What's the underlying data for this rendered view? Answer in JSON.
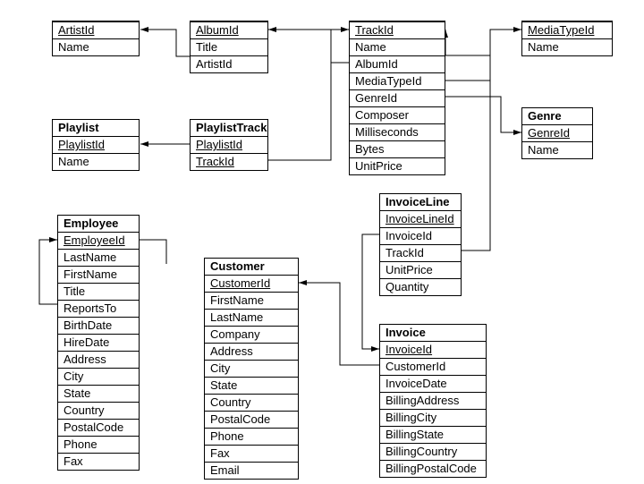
{
  "entities": {
    "artist": {
      "title": "",
      "fields": [
        {
          "name": "ArtistId",
          "pk": true
        },
        {
          "name": "Name"
        }
      ]
    },
    "album": {
      "title": "",
      "fields": [
        {
          "name": "AlbumId",
          "pk": true
        },
        {
          "name": "Title"
        },
        {
          "name": "ArtistId"
        }
      ]
    },
    "track": {
      "title": "",
      "fields": [
        {
          "name": "TrackId",
          "pk": true
        },
        {
          "name": "Name"
        },
        {
          "name": "AlbumId"
        },
        {
          "name": "MediaTypeId"
        },
        {
          "name": "GenreId"
        },
        {
          "name": "Composer"
        },
        {
          "name": "Milliseconds"
        },
        {
          "name": "Bytes"
        },
        {
          "name": "UnitPrice"
        }
      ]
    },
    "mediatype": {
      "title": "",
      "fields": [
        {
          "name": "MediaTypeId",
          "pk": true
        },
        {
          "name": "Name"
        }
      ]
    },
    "genre": {
      "title": "Genre",
      "fields": [
        {
          "name": "GenreId",
          "pk": true
        },
        {
          "name": "Name"
        }
      ]
    },
    "playlist": {
      "title": "Playlist",
      "fields": [
        {
          "name": "PlaylistId",
          "pk": true
        },
        {
          "name": "Name"
        }
      ]
    },
    "playlisttrack": {
      "title": "PlaylistTrack",
      "fields": [
        {
          "name": "PlaylistId",
          "pk": true
        },
        {
          "name": "TrackId",
          "pk": true
        }
      ]
    },
    "employee": {
      "title": "Employee",
      "fields": [
        {
          "name": "EmployeeId",
          "pk": true
        },
        {
          "name": "LastName"
        },
        {
          "name": "FirstName"
        },
        {
          "name": "Title"
        },
        {
          "name": "ReportsTo"
        },
        {
          "name": "BirthDate"
        },
        {
          "name": "HireDate"
        },
        {
          "name": "Address"
        },
        {
          "name": "City"
        },
        {
          "name": "State"
        },
        {
          "name": "Country"
        },
        {
          "name": "PostalCode"
        },
        {
          "name": "Phone"
        },
        {
          "name": "Fax"
        }
      ]
    },
    "customer": {
      "title": "Customer",
      "fields": [
        {
          "name": "CustomerId",
          "pk": true
        },
        {
          "name": "FirstName"
        },
        {
          "name": "LastName"
        },
        {
          "name": "Company"
        },
        {
          "name": "Address"
        },
        {
          "name": "City"
        },
        {
          "name": "State"
        },
        {
          "name": "Country"
        },
        {
          "name": "PostalCode"
        },
        {
          "name": "Phone"
        },
        {
          "name": "Fax"
        },
        {
          "name": "Email"
        }
      ]
    },
    "invoiceline": {
      "title": "InvoiceLine",
      "fields": [
        {
          "name": "InvoiceLineId",
          "pk": true
        },
        {
          "name": "InvoiceId"
        },
        {
          "name": "TrackId"
        },
        {
          "name": "UnitPrice"
        },
        {
          "name": "Quantity"
        }
      ]
    },
    "invoice": {
      "title": "Invoice",
      "fields": [
        {
          "name": "InvoiceId",
          "pk": true
        },
        {
          "name": "CustomerId"
        },
        {
          "name": "InvoiceDate"
        },
        {
          "name": "BillingAddress"
        },
        {
          "name": "BillingCity"
        },
        {
          "name": "BillingState"
        },
        {
          "name": "BillingCountry"
        },
        {
          "name": "BillingPostalCode"
        }
      ]
    }
  },
  "relationships": [
    {
      "from": "album.ArtistId",
      "to": "artist.ArtistId"
    },
    {
      "from": "track.AlbumId",
      "to": "album.AlbumId"
    },
    {
      "from": "track.MediaTypeId",
      "to": "mediatype.MediaTypeId"
    },
    {
      "from": "track.GenreId",
      "to": "genre.GenreId"
    },
    {
      "from": "playlisttrack.PlaylistId",
      "to": "playlist.PlaylistId"
    },
    {
      "from": "playlisttrack.TrackId",
      "to": "track.TrackId"
    },
    {
      "from": "invoiceline.TrackId",
      "to": "track.TrackId"
    },
    {
      "from": "invoiceline.InvoiceId",
      "to": "invoice.InvoiceId"
    },
    {
      "from": "invoice.CustomerId",
      "to": "customer.CustomerId"
    },
    {
      "from": "employee.ReportsTo",
      "to": "employee.EmployeeId"
    }
  ]
}
